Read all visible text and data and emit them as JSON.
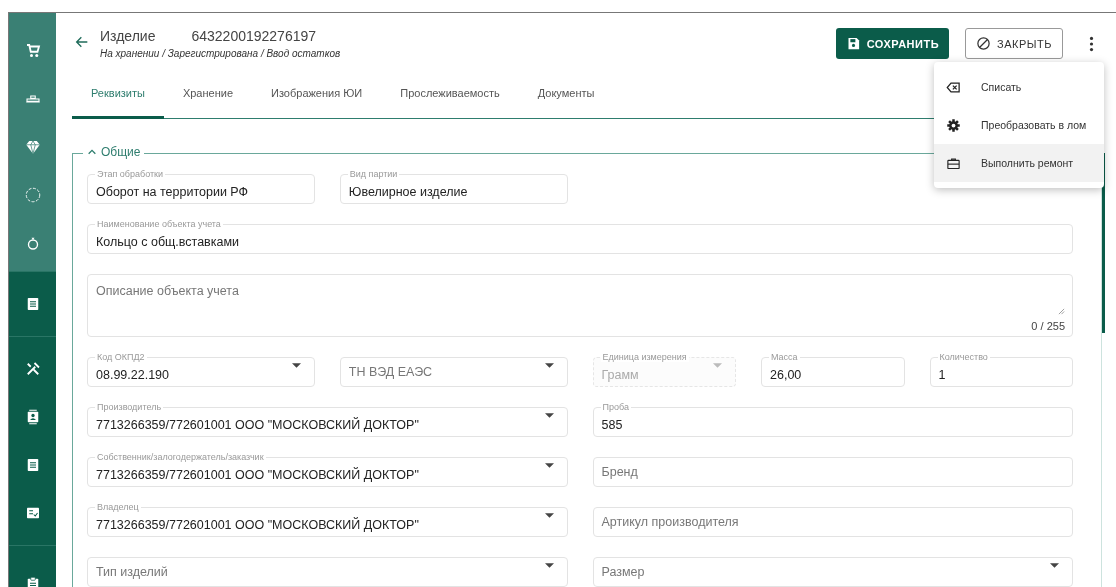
{
  "header": {
    "title": "Изделие",
    "number": "6432200192276197",
    "breadcrumb": "На хранении / Зарегистрирована / Ввод остатков",
    "save_label": "СОХРАНИТЬ",
    "close_label": "ЗАКРЫТЬ"
  },
  "tabs": [
    {
      "label": "Реквизиты",
      "selected": true
    },
    {
      "label": "Хранение",
      "selected": false
    },
    {
      "label": "Изображения ЮИ",
      "selected": false
    },
    {
      "label": "Прослеживаемость",
      "selected": false
    },
    {
      "label": "Документы",
      "selected": false
    }
  ],
  "menu": [
    {
      "kind": "writeoff",
      "label": "Списать",
      "selected": false
    },
    {
      "kind": "convert",
      "label": "Преобразовать в лом",
      "selected": false
    },
    {
      "kind": "repair",
      "label": "Выполнить ремонт",
      "selected": true
    }
  ],
  "section": {
    "title": "Общие",
    "expanded": true
  },
  "rows": [
    {
      "kind": "split",
      "left": [
        {
          "kind": "text",
          "label": "Этап обработки",
          "value": "Оборот на территории РФ",
          "disabled": false
        },
        {
          "kind": "text",
          "label": "Вид партии",
          "value": "Ювелирное изделие",
          "disabled": false
        }
      ],
      "right": []
    },
    {
      "kind": "full",
      "field": {
        "kind": "text",
        "label": "Наименование объекта учета",
        "value": "Кольцо с общ.вставками",
        "disabled": false
      }
    },
    {
      "kind": "full",
      "field": {
        "kind": "textarea",
        "placeholder": "Описание объекта учета",
        "counter": "0 / 255",
        "disabled": false
      }
    },
    {
      "kind": "split",
      "left": [
        {
          "kind": "select",
          "label": "Код ОКПД2",
          "value": "08.99.22.190",
          "disabled": false
        },
        {
          "kind": "select",
          "placeholder": "ТН ВЭД ЕАЭС",
          "disabled": false
        }
      ],
      "right": [
        {
          "kind": "select",
          "label": "Единица измерения",
          "value": "Грамм",
          "disabled": true
        },
        {
          "kind": "text",
          "label": "Масса",
          "value": "26,00",
          "disabled": false
        },
        {
          "kind": "text",
          "label": "Количество",
          "value": "1",
          "disabled": false
        }
      ]
    },
    {
      "kind": "split",
      "left": [
        {
          "kind": "select",
          "label": "Производитель",
          "value": "7713266359/772601001 ООО \"МОСКОВСКИЙ ДОКТОР\"",
          "disabled": false
        }
      ],
      "right": [
        {
          "kind": "text",
          "label": "Проба",
          "value": "585",
          "disabled": false
        }
      ]
    },
    {
      "kind": "split",
      "left": [
        {
          "kind": "select",
          "label": "Собственник/залогодержатель/заказчик",
          "value": "7713266359/772601001 ООО \"МОСКОВСКИЙ ДОКТОР\"",
          "disabled": false
        }
      ],
      "right": [
        {
          "kind": "text",
          "placeholder": "Бренд",
          "disabled": false
        }
      ]
    },
    {
      "kind": "split",
      "left": [
        {
          "kind": "select",
          "label": "Владелец",
          "value": "7713266359/772601001 ООО \"МОСКОВСКИЙ ДОКТОР\"",
          "disabled": false
        }
      ],
      "right": [
        {
          "kind": "text",
          "placeholder": "Артикул производителя",
          "disabled": false
        }
      ]
    },
    {
      "kind": "split",
      "left": [
        {
          "kind": "select",
          "placeholder": "Тип изделий",
          "disabled": false
        }
      ],
      "right": [
        {
          "kind": "select",
          "placeholder": "Размер",
          "disabled": false
        }
      ]
    }
  ]
}
